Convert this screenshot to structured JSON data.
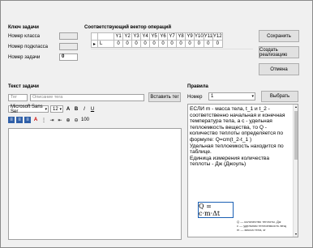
{
  "task_key": {
    "title": "Ключ задачи",
    "class_label": "Номер класса",
    "subclass_label": "Номер подкласса",
    "task_label": "Номер задачи",
    "task_value": "0"
  },
  "op_vector": {
    "title": "Соответствующий вектор операций",
    "headers": [
      "Y1",
      "Y2",
      "Y3",
      "Y4",
      "Y5",
      "Y6",
      "Y7",
      "Y8",
      "Y9",
      "Y10",
      "Y11",
      "Y12"
    ],
    "row_name": "L",
    "row_values": [
      "0",
      "0",
      "0",
      "0",
      "0",
      "0",
      "0",
      "0",
      "0",
      "0",
      "0",
      "0"
    ]
  },
  "buttons": {
    "save": "Сохранить",
    "create": "Создать реализацию",
    "cancel": "Отмена",
    "insert_tag": "Вставить тег",
    "choose": "Выбрать"
  },
  "task_text": {
    "title": "Текст задачи",
    "field1_placeholder": "Тег",
    "field2_placeholder": "Описание тега",
    "font_name": "Microsoft Sans Ser",
    "font_size": "12",
    "zoom": "100"
  },
  "rules": {
    "title": "Правила",
    "number_label": "Номер",
    "number_value": "1",
    "text": "ЕСЛИ m - масса тела, t_1 и t_2 - соответственно начальная и конечная температура тела, а c - удельная теплоемкость вещества, то Q - количество теплоты определяется по формуле: Q=cm(t_2-t_1 )\nУдельная теплоемкость находится по таблице.\nЕдиница измерения количества теплоты - Дж (Джоуль)",
    "formula": "Q = c·m·Δt",
    "formula_note1": "Q — количество теплоты, Дж",
    "formula_note2": "c — удельная теплоемкость вещ",
    "formula_note3": "m — масса тела, кг"
  }
}
